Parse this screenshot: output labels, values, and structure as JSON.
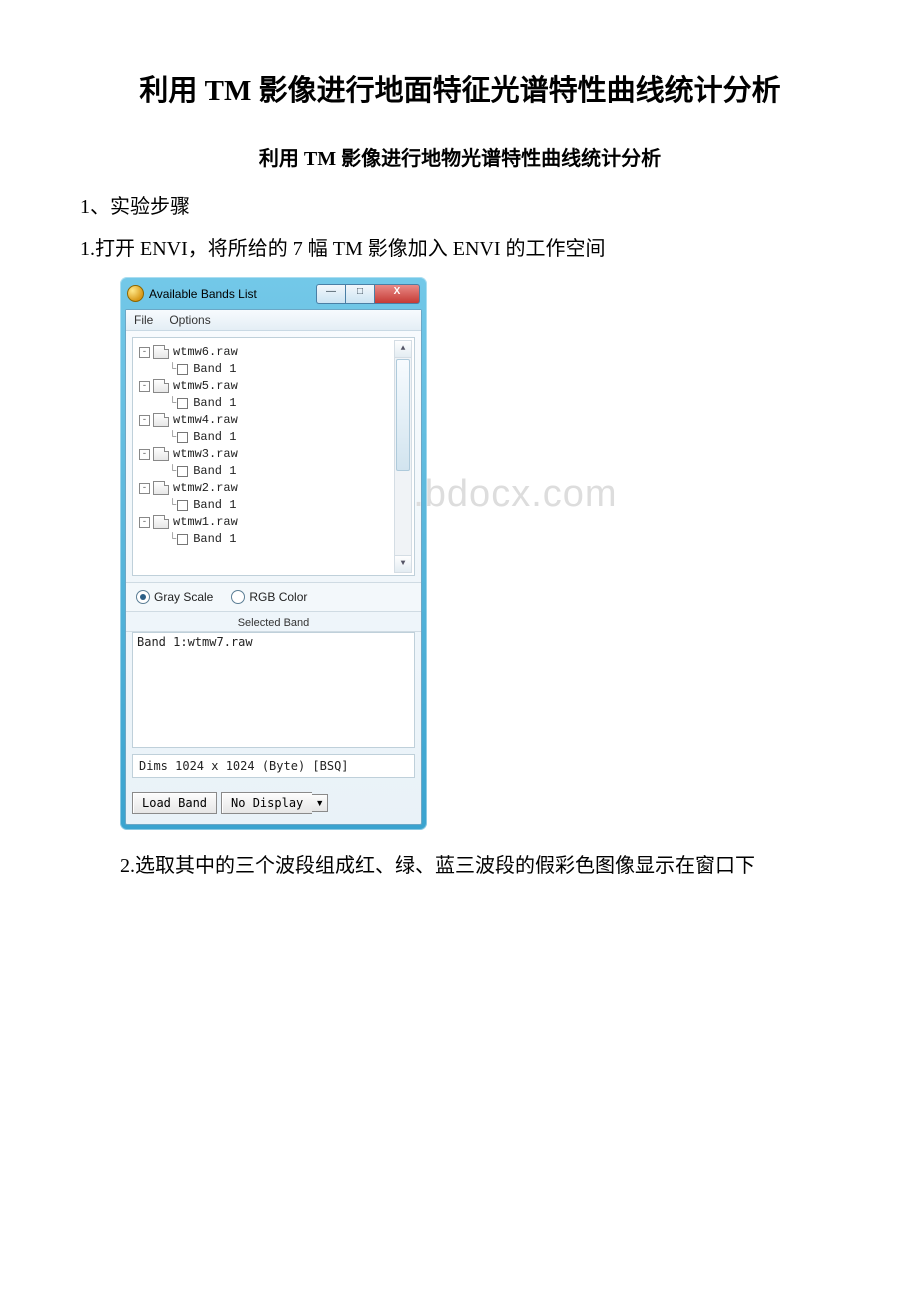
{
  "doc": {
    "title": "利用 TM 影像进行地面特征光谱特性曲线统计分析",
    "subtitle": "利用 TM 影像进行地物光谱特性曲线统计分析",
    "step_heading": "1、实验步骤",
    "step1": "1.打开 ENVI，将所给的 7 幅 TM 影像加入 ENVI 的工作空间",
    "step2": "2.选取其中的三个波段组成红、绿、蓝三波段的假彩色图像显示在窗口下",
    "watermark": "www.bdocx.com"
  },
  "window": {
    "title": "Available Bands List",
    "menu": {
      "file": "File",
      "options": "Options"
    },
    "tree": [
      {
        "file": "wtmw6.raw",
        "band": "Band 1"
      },
      {
        "file": "wtmw5.raw",
        "band": "Band 1"
      },
      {
        "file": "wtmw4.raw",
        "band": "Band 1"
      },
      {
        "file": "wtmw3.raw",
        "band": "Band 1"
      },
      {
        "file": "wtmw2.raw",
        "band": "Band 1"
      },
      {
        "file": "wtmw1.raw",
        "band": "Band 1"
      }
    ],
    "radio": {
      "gray": "Gray Scale",
      "rgb": "RGB Color"
    },
    "selected_band_label": "Selected Band",
    "selected_band_value": "Band 1:wtmw7.raw",
    "dims": "Dims 1024 x 1024 (Byte) [BSQ]",
    "buttons": {
      "load": "Load Band",
      "display": "No Display"
    },
    "winbtns": {
      "min": "—",
      "max": "□",
      "close": "X"
    },
    "scroll": {
      "up": "▲",
      "down": "▼"
    }
  }
}
